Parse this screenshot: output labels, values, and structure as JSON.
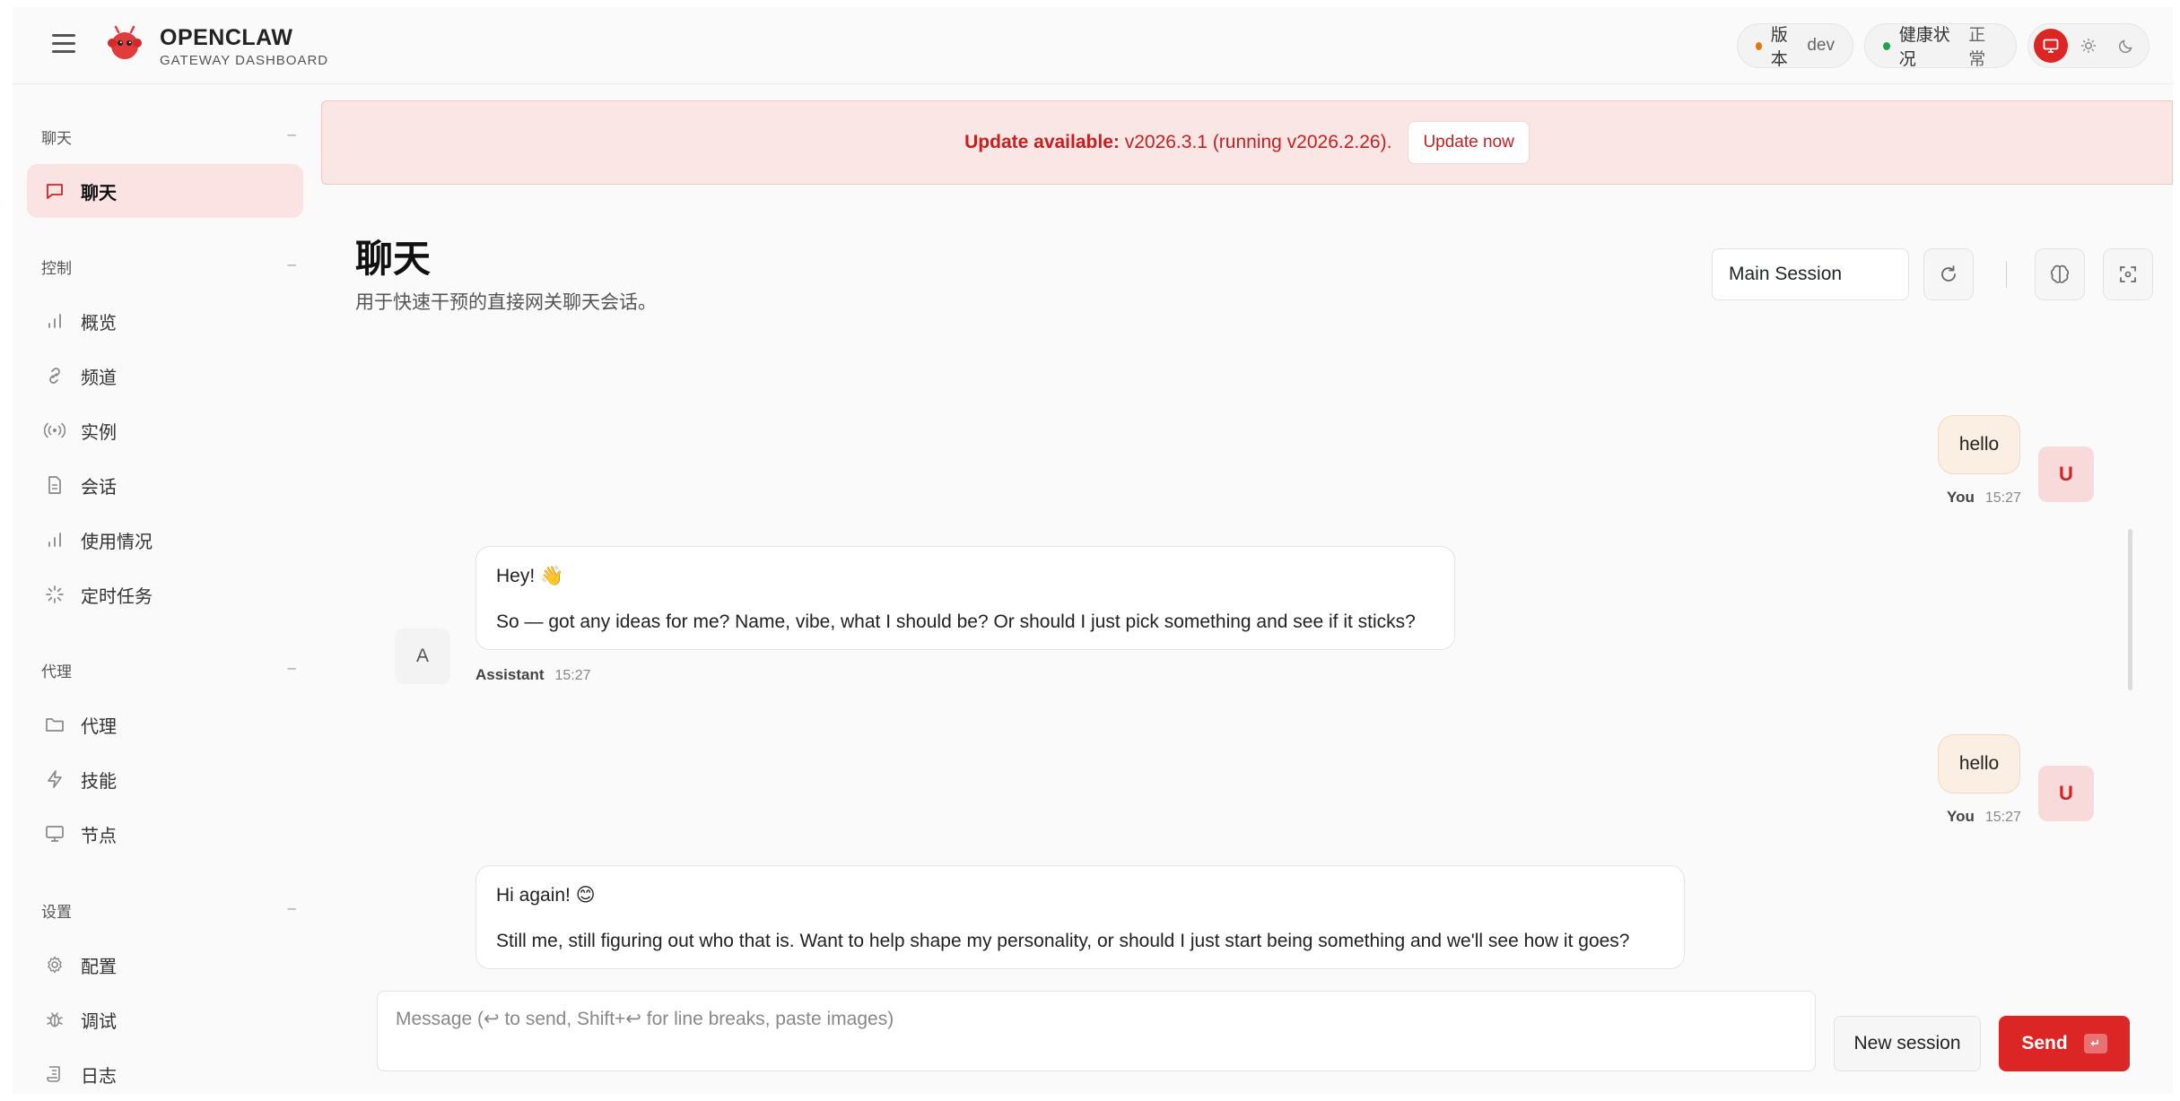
{
  "brand": {
    "title": "OPENCLAW",
    "subtitle": "GATEWAY DASHBOARD"
  },
  "header": {
    "version_label": "版本",
    "version_value": "dev",
    "health_label": "健康状况",
    "health_value": "正常",
    "theme_options": [
      "monitor-icon",
      "sun-icon",
      "moon-icon"
    ],
    "accent": "#dc2626"
  },
  "sidebar": {
    "groups": [
      {
        "title": "聊天",
        "items": [
          {
            "label": "聊天",
            "icon": "message-icon",
            "active": true
          }
        ]
      },
      {
        "title": "控制",
        "items": [
          {
            "label": "概览",
            "icon": "bar-chart-icon"
          },
          {
            "label": "频道",
            "icon": "link-icon"
          },
          {
            "label": "实例",
            "icon": "radio-icon"
          },
          {
            "label": "会话",
            "icon": "file-icon"
          },
          {
            "label": "使用情况",
            "icon": "bar-chart-icon"
          },
          {
            "label": "定时任务",
            "icon": "loader-icon"
          }
        ]
      },
      {
        "title": "代理",
        "items": [
          {
            "label": "代理",
            "icon": "folder-icon"
          },
          {
            "label": "技能",
            "icon": "zap-icon"
          },
          {
            "label": "节点",
            "icon": "monitor-icon"
          }
        ]
      },
      {
        "title": "设置",
        "items": [
          {
            "label": "配置",
            "icon": "gear-icon"
          },
          {
            "label": "调试",
            "icon": "bug-icon"
          },
          {
            "label": "日志",
            "icon": "scroll-icon"
          }
        ]
      }
    ],
    "collapse_glyph": "–"
  },
  "banner": {
    "prefix": "Update available:",
    "message": "v2026.3.1 (running v2026.2.26).",
    "button": "Update now"
  },
  "page": {
    "title": "聊天",
    "subtitle": "用于快速干预的直接网关聊天会话。",
    "session_select": "Main Session"
  },
  "messages": [
    {
      "role": "user",
      "text": "hello",
      "sender": "You",
      "time": "15:27",
      "avatar": "U"
    },
    {
      "role": "assistant",
      "lines": [
        "Hey! 👋",
        "So — got any ideas for me? Name, vibe, what I should be? Or should I just pick something and see if it sticks?"
      ],
      "sender": "Assistant",
      "time": "15:27",
      "avatar": "A"
    },
    {
      "role": "user",
      "text": "hello",
      "sender": "You",
      "time": "15:27",
      "avatar": "U"
    },
    {
      "role": "assistant",
      "lines": [
        "Hi again! 😊",
        "Still me, still figuring out who that is. Want to help shape my personality, or should I just start being something and we'll see how it goes?"
      ]
    }
  ],
  "composer": {
    "placeholder": "Message (↩ to send, Shift+↩ for line breaks, paste images)",
    "new_session": "New session",
    "send": "Send",
    "send_kbd": "↵"
  }
}
